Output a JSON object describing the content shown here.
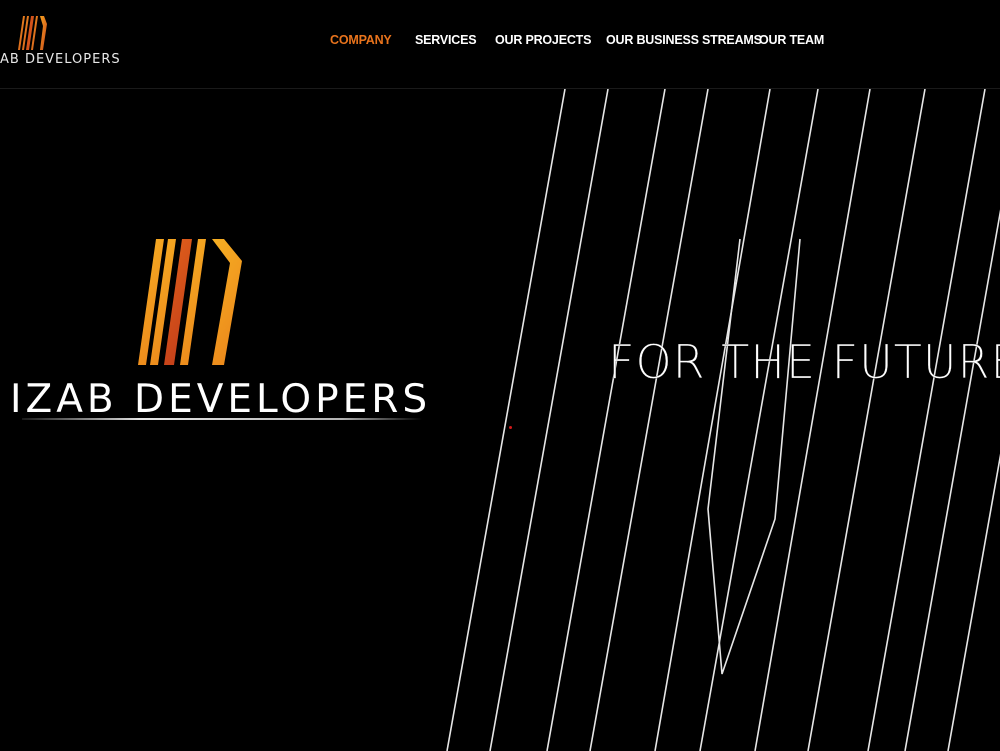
{
  "header": {
    "logo_text": "AB DEVELOPERS",
    "nav": [
      {
        "label": "COMPANY",
        "active": true
      },
      {
        "label": "SERVICES",
        "active": false
      },
      {
        "label": "OUR PROJECTS",
        "active": false
      },
      {
        "label": "OUR BUSINESS STREAMS",
        "active": false
      },
      {
        "label": "OUR TEAM",
        "active": false
      }
    ]
  },
  "hero": {
    "brand": "IZAB DEVELOPERS",
    "tagline": "FOR THE FUTURE"
  },
  "colors": {
    "background": "#000000",
    "accent": "#e8731c",
    "logo_gradient": [
      "#f6a21f",
      "#d4461b"
    ],
    "text": "#ffffff"
  },
  "icons": {
    "logo_mark": "stylized-striped-letter-logo-icon"
  }
}
